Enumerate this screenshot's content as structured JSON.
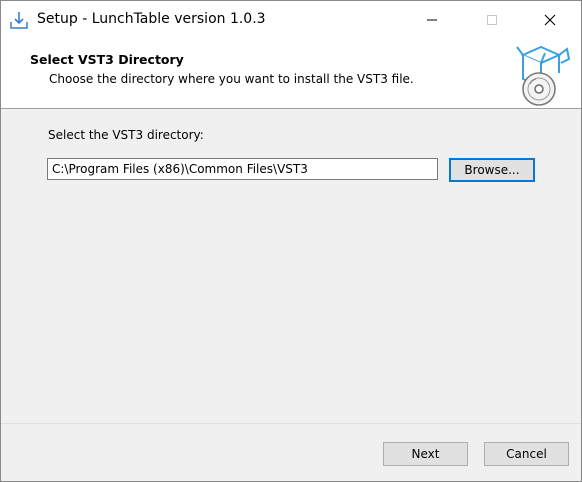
{
  "window": {
    "title": "Setup - LunchTable version 1.0.3"
  },
  "header": {
    "title": "Select VST3 Directory",
    "subtitle": "Choose the directory where you want to install the VST3 file."
  },
  "form": {
    "label": "Select the VST3 directory:",
    "path_value": "C:\\Program Files (x86)\\Common Files\\VST3",
    "browse_label": "Browse..."
  },
  "footer": {
    "next_label": "Next",
    "cancel_label": "Cancel"
  },
  "colors": {
    "accent": "#0078d7",
    "graphic_blue": "#3aa0e0"
  }
}
